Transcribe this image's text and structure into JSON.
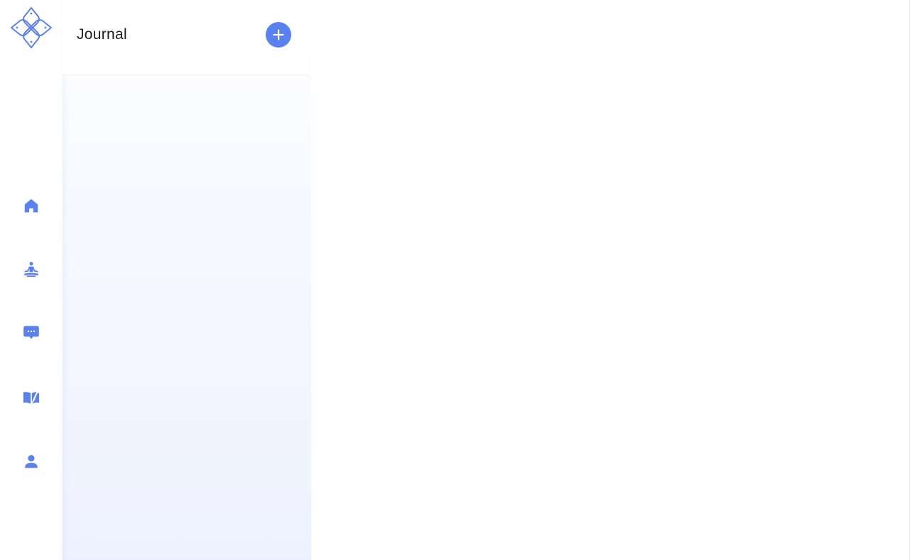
{
  "colors": {
    "accent": "#5a81f0",
    "title_text": "#1e1e28",
    "panel_tint": "#eef2ff"
  },
  "rail": {
    "logo_icon": "four-petal-logo-icon",
    "items": [
      {
        "icon": "home-icon"
      },
      {
        "icon": "meditation-icon"
      },
      {
        "icon": "chat-bubble-icon"
      },
      {
        "icon": "open-book-icon"
      },
      {
        "icon": "person-icon"
      }
    ]
  },
  "journal": {
    "title": "Journal",
    "add_icon": "plus-icon"
  }
}
